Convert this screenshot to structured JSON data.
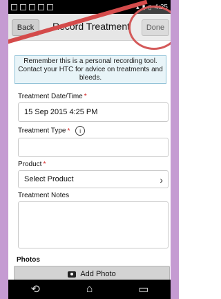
{
  "statusbar": {
    "time": "4:25"
  },
  "titlebar": {
    "back_label": "Back",
    "title": "Record Treatment",
    "done_label": "Done"
  },
  "notice": {
    "text": "Remember this is a personal recording tool. Contact your HTC for advice on treatments and bleeds."
  },
  "form": {
    "date_label": "Treatment Date/Time",
    "date_value": "15 Sep 2015 4:25 PM",
    "type_label": "Treatment Type",
    "type_value": "",
    "product_label": "Product",
    "product_value": "Select Product",
    "notes_label": "Treatment Notes",
    "notes_value": ""
  },
  "photos": {
    "label": "Photos",
    "add_label": "Add Photo"
  },
  "icons": {
    "info": "info-icon",
    "chevron": "chevron-right-icon",
    "camera": "camera-icon",
    "nav_back": "back-icon",
    "nav_home": "home-icon",
    "nav_recent": "recent-apps-icon"
  },
  "colors": {
    "required": "#d31f1f",
    "highlight": "#d45a5a",
    "notice_bg": "#e8f4f8",
    "notice_border": "#8cc0d6"
  }
}
